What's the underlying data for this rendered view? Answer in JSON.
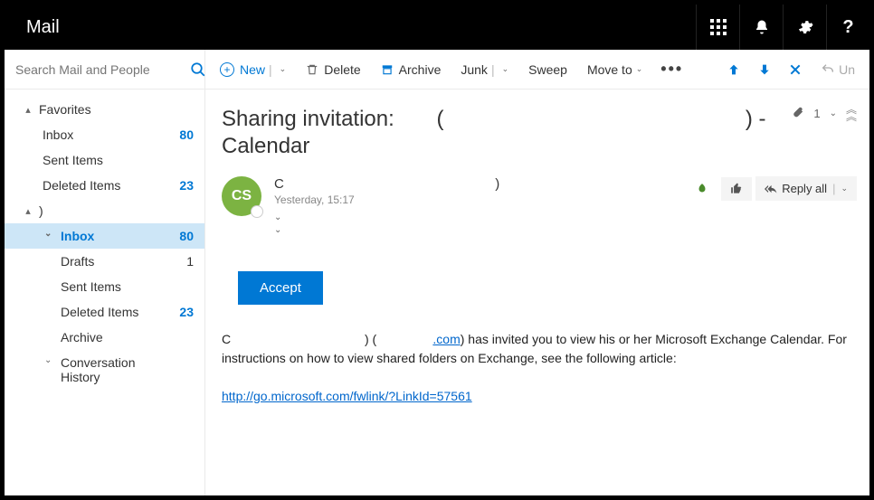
{
  "app": {
    "title": "Mail"
  },
  "titlebar_icons": {
    "waffle": "app-launcher-icon",
    "bell": "notifications-icon",
    "gear": "settings-icon",
    "help": "help-icon"
  },
  "search": {
    "placeholder": "Search Mail and People"
  },
  "sidebar": {
    "favorites_label": "Favorites",
    "fav_items": [
      {
        "label": "Inbox",
        "count": "80"
      },
      {
        "label": "Sent Items",
        "count": ""
      },
      {
        "label": "Deleted Items",
        "count": "23"
      }
    ],
    "account_label": ")",
    "account_items": [
      {
        "label": "Inbox",
        "count": "80",
        "selected": true,
        "hasChevron": true
      },
      {
        "label": "Drafts",
        "count": "1",
        "dark": true
      },
      {
        "label": "Sent Items",
        "count": ""
      },
      {
        "label": "Deleted Items",
        "count": "23"
      },
      {
        "label": "Archive",
        "count": ""
      },
      {
        "label": "Conversation History",
        "count": "",
        "hasChevron": true
      }
    ]
  },
  "toolbar": {
    "new": "New",
    "delete": "Delete",
    "archive": "Archive",
    "junk": "Junk",
    "sweep": "Sweep",
    "moveto": "Move to",
    "undo": "Un"
  },
  "message": {
    "subject_line1": "Sharing invitation:",
    "subject_paren_open": "(",
    "subject_paren_close": ") -",
    "subject_line2": "Calendar",
    "attachment_count": "1",
    "avatar_initials": "CS",
    "from_display": "C",
    "from_paren_close": ")",
    "timestamp": "Yesterday, 15:17",
    "reply_all": "Reply all",
    "accept_label": "Accept",
    "body_before_link": ") (",
    "body_link_domain": ".com",
    "body_after_domain": ") has invited you to view his or her Microsoft Exchange Calendar. For instructions on how to view shared folders on Exchange, see the following article:",
    "help_link": "http://go.microsoft.com/fwlink/?LinkId=57561"
  }
}
